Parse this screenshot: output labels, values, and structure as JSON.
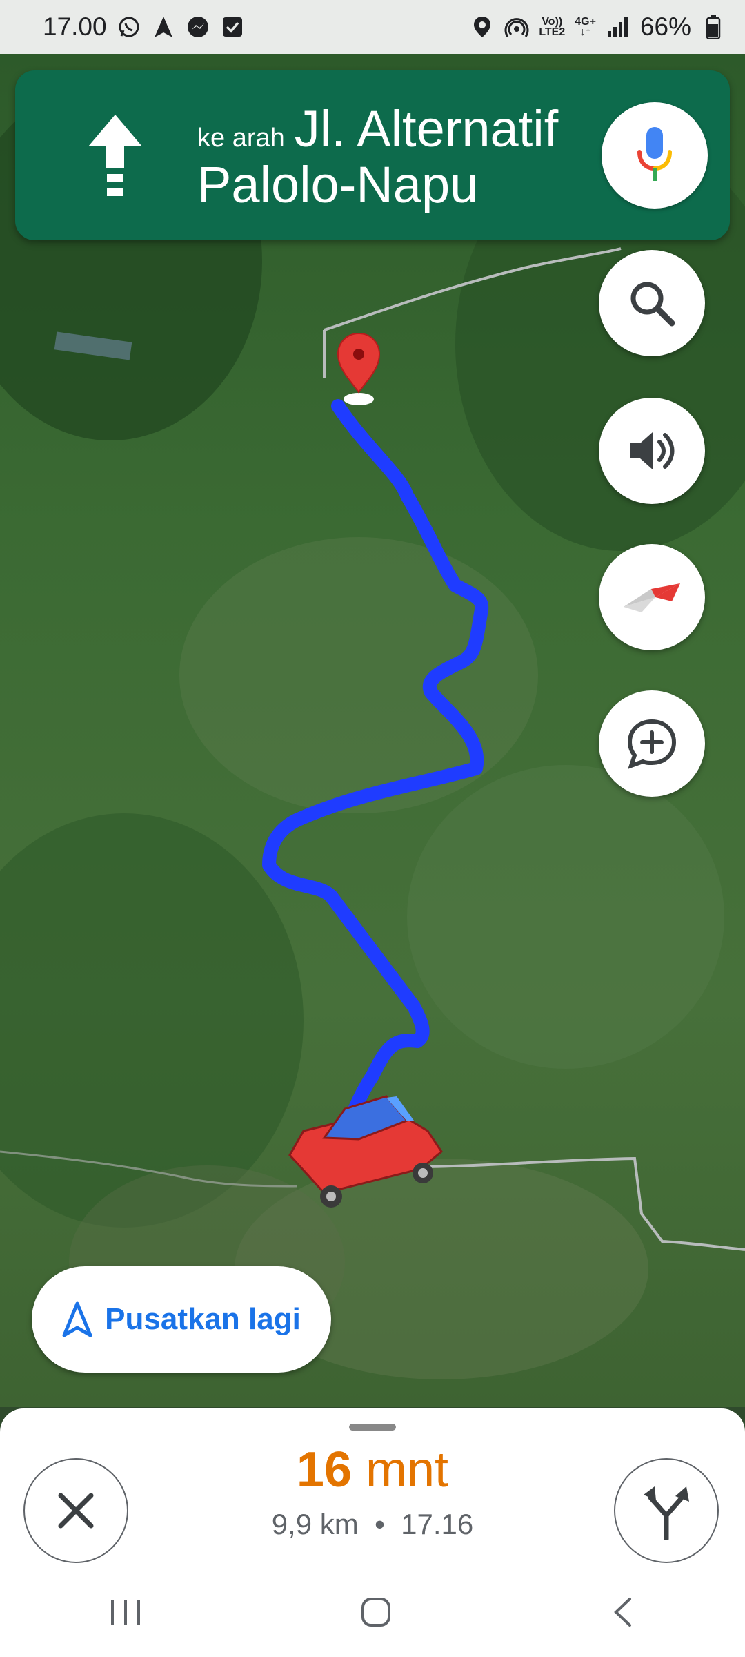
{
  "status_bar": {
    "time": "17.00",
    "battery": "66%",
    "volte_top": "Vo))",
    "volte_bottom": "LTE2",
    "net_type": "4G+"
  },
  "banner": {
    "toward": "ke arah",
    "street_line1": "Jl. Alternatif",
    "street_line2": "Palolo-Napu",
    "icon": "straight-arrow-icon",
    "color": "#0d6b4c"
  },
  "map_controls": [
    "search-icon",
    "volume-icon",
    "compass-icon",
    "add-comment-icon"
  ],
  "route": {
    "color": "#1f3cff"
  },
  "recenter": {
    "label": "Pusatkan lagi",
    "accent": "#1a73e8"
  },
  "trip": {
    "duration_value": "16",
    "duration_unit": "mnt",
    "distance": "9,9 km",
    "separator": "•",
    "arrival": "17.16",
    "accent": "#e37400"
  }
}
